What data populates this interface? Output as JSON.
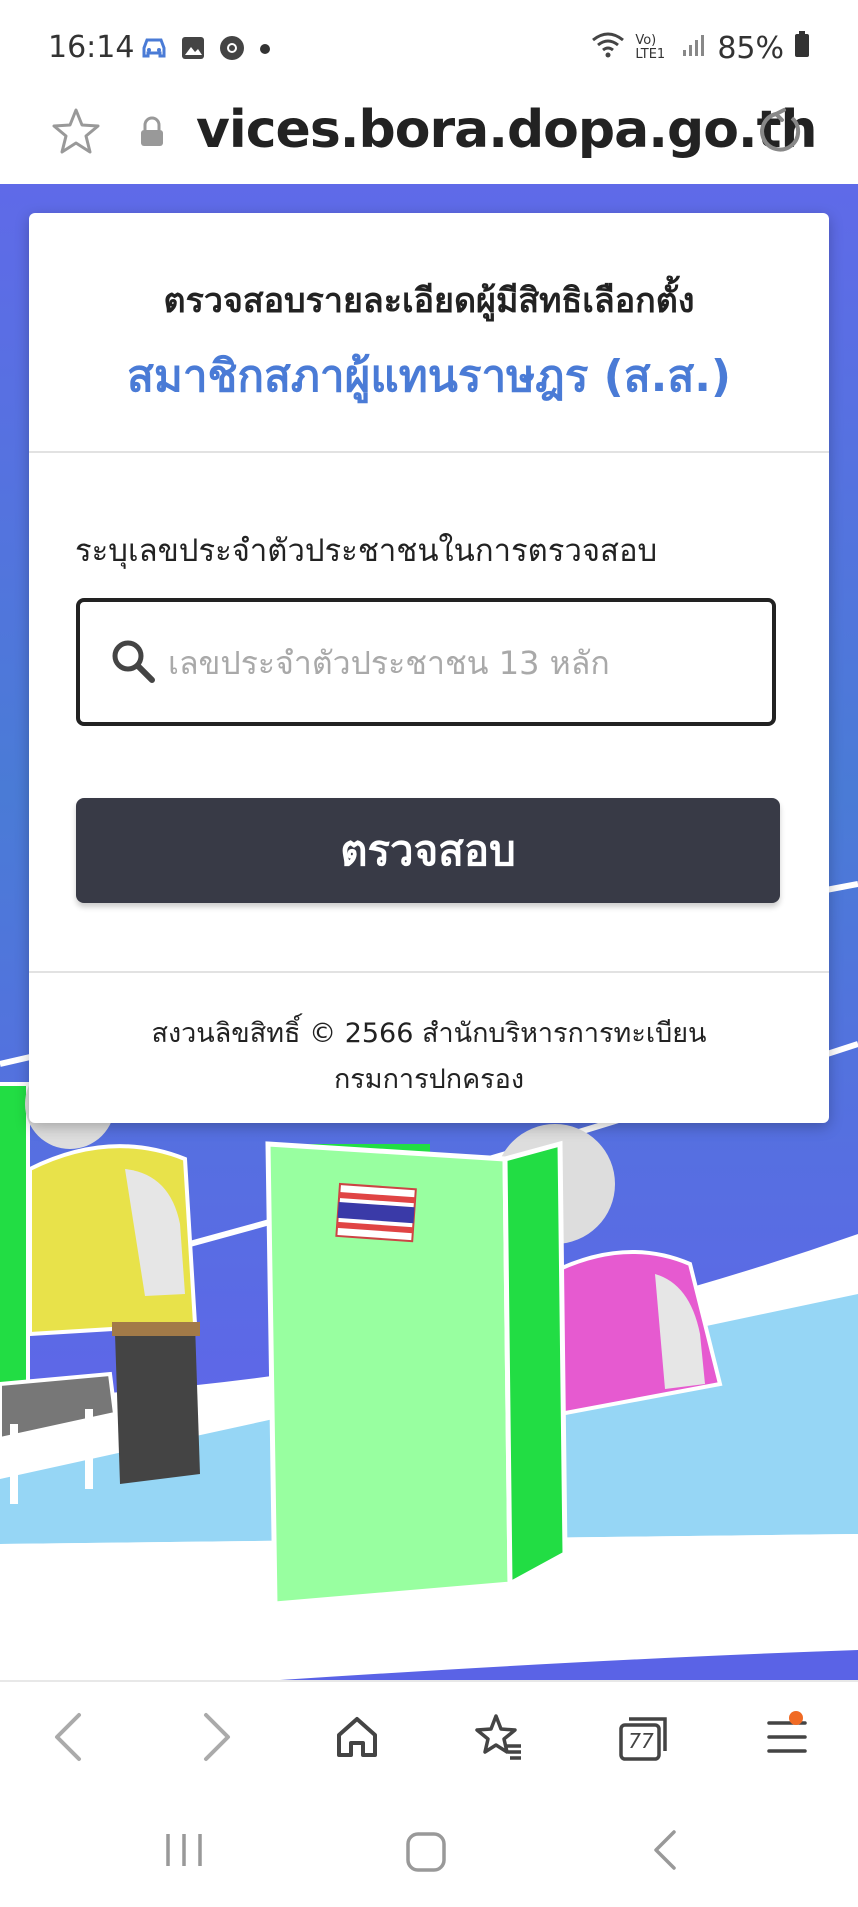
{
  "status_bar": {
    "time": "16:14",
    "battery": "85%",
    "network": "Vo) LTE1",
    "icons": [
      "car-icon",
      "image-icon",
      "chrome-icon",
      "dot-icon",
      "wifi-icon",
      "signal-icon",
      "battery-icon"
    ]
  },
  "url_bar": {
    "url": "vices.bora.dopa.go.th",
    "icons": [
      "star-icon",
      "lock-icon",
      "reload-icon"
    ]
  },
  "card": {
    "title_line1": "ตรวจสอบรายละเอียดผู้มีสิทธิเลือกตั้ง",
    "title_line2": "สมาชิกสภาผู้แทนราษฎร (ส.ส.)",
    "title_color": "#4a7bd6",
    "form_label": "ระบุเลขประจำตัวประชาชนในการตรวจสอบ",
    "search_placeholder": "เลขประจำตัวประชาชน 13 หลัก",
    "search_value": "",
    "submit_label": "ตรวจสอบ",
    "footer_line1": "สงวนลิขสิทธิ์ © 2566 สำนักบริหารการทะเบียน",
    "footer_line2": "กรมการปกครอง"
  },
  "browser_nav": {
    "tab_count": "77",
    "icons": [
      "back-icon",
      "forward-icon",
      "home-icon",
      "bookmarks-icon",
      "tabs-icon",
      "menu-icon"
    ]
  },
  "colors": {
    "background_blue": "#5c67e6",
    "button_dark": "#383a46",
    "accent_orange": "#f06a24"
  }
}
